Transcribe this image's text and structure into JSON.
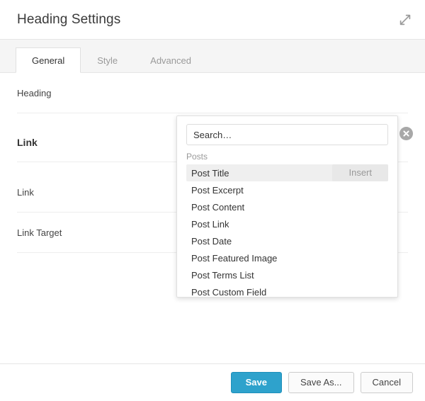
{
  "window": {
    "title": "Heading Settings",
    "expand_icon": "expand-diagonal-icon"
  },
  "tabs": [
    {
      "label": "General",
      "active": true
    },
    {
      "label": "Style",
      "active": false
    },
    {
      "label": "Advanced",
      "active": false
    }
  ],
  "form": {
    "rows": [
      {
        "type": "field",
        "label": "Heading",
        "value": ""
      },
      {
        "type": "section",
        "label": "Link"
      },
      {
        "type": "field",
        "label": "Link",
        "value": ""
      },
      {
        "type": "field",
        "label": "Link Target",
        "value": ""
      }
    ]
  },
  "remove_icon": {
    "name": "remove-circle-x-icon"
  },
  "picker": {
    "search": {
      "value": "Search…",
      "placeholder": "Search…"
    },
    "group_label": "Posts",
    "insert_label": "Insert",
    "items": [
      {
        "label": "Post Title",
        "selected": true
      },
      {
        "label": "Post Excerpt",
        "selected": false
      },
      {
        "label": "Post Content",
        "selected": false
      },
      {
        "label": "Post Link",
        "selected": false
      },
      {
        "label": "Post Date",
        "selected": false
      },
      {
        "label": "Post Featured Image",
        "selected": false
      },
      {
        "label": "Post Terms List",
        "selected": false
      },
      {
        "label": "Post Custom Field",
        "selected": false
      }
    ]
  },
  "footer": {
    "save_label": "Save",
    "save_as_label": "Save As...",
    "cancel_label": "Cancel"
  },
  "colors": {
    "primary": "#2ea2cc",
    "border": "#e5e5e5",
    "selected_row": "#efefef",
    "muted_text": "#999999"
  }
}
